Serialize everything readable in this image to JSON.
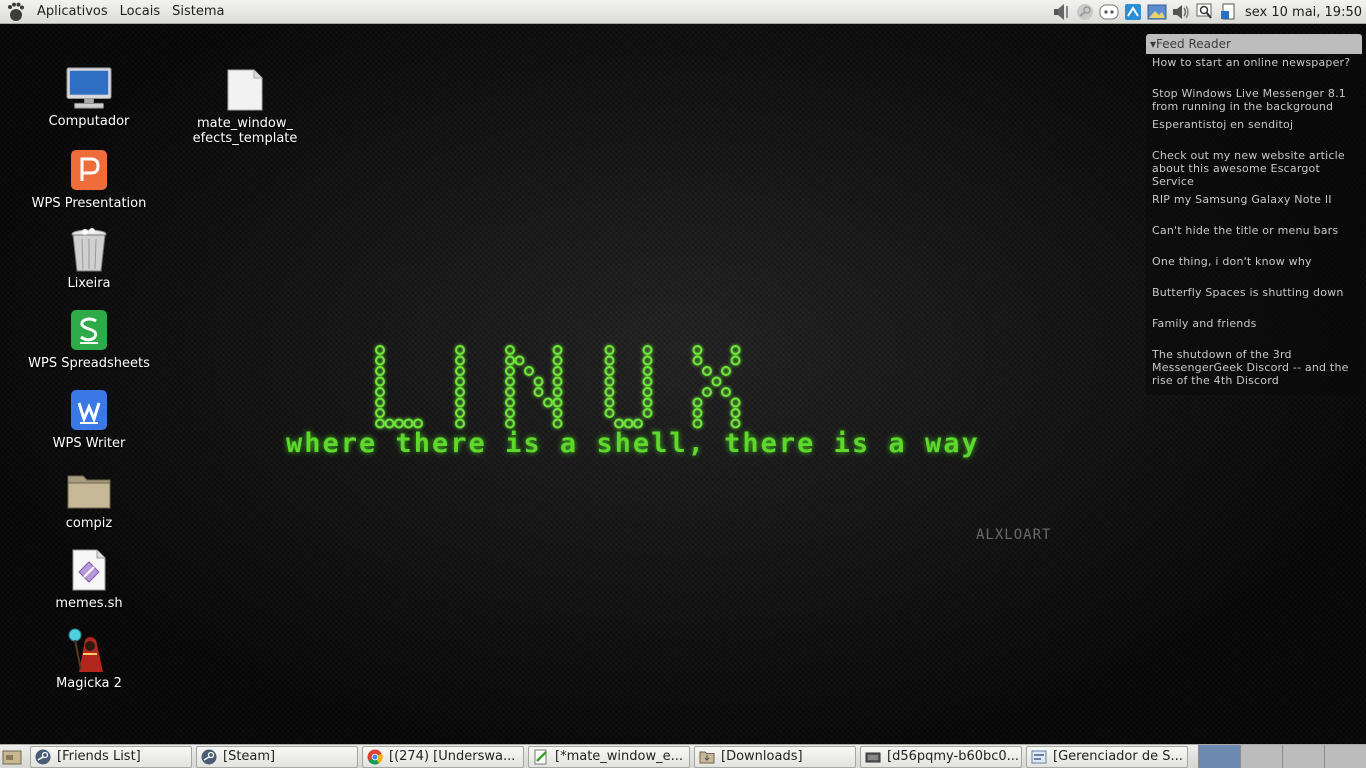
{
  "top_panel": {
    "menus": [
      "Aplicativos",
      "Locais",
      "Sistema"
    ],
    "clock": "sex 10 mai, 19:50"
  },
  "desktop_icons": [
    {
      "label": "Computador",
      "icon": "computer-icon"
    },
    {
      "label": "WPS Presentation",
      "icon": "wps-presentation-icon"
    },
    {
      "label": "Lixeira",
      "icon": "trash-icon"
    },
    {
      "label": "WPS Spreadsheets",
      "icon": "wps-spreadsheets-icon"
    },
    {
      "label": "WPS Writer",
      "icon": "wps-writer-icon"
    },
    {
      "label": "compiz",
      "icon": "folder-icon"
    },
    {
      "label": "memes.sh",
      "icon": "script-file-icon"
    },
    {
      "label": "Magicka 2",
      "icon": "magicka-game-icon"
    },
    {
      "label": "mate_window_\nefects_template",
      "icon": "blank-file-icon"
    }
  ],
  "wallpaper": {
    "title": "LINUX",
    "tagline": "where there is a shell, there is a way",
    "artist": "ALXLOART",
    "accent": "#5ed82a"
  },
  "feed_reader": {
    "title": "Feed Reader",
    "items": [
      "How to start an online newspaper?",
      "Stop Windows Live Messenger 8.1 from running in the background",
      "Esperantistoj en senditoj",
      "Check out my new website article about this awesome Escargot Service",
      "RIP my Samsung Galaxy Note II",
      "Can't hide the title or menu bars",
      "One thing, i don't know why",
      "Butterfly Spaces is shutting down",
      "Family and friends",
      "The shutdown of the 3rd MessengerGeek Discord -- and the rise of the 4th Discord"
    ]
  },
  "taskbar": {
    "tasks": [
      {
        "label": "[Friends List]",
        "icon": "steam-icon"
      },
      {
        "label": "[Steam]",
        "icon": "steam-icon"
      },
      {
        "label": "[(274) [Underswa...",
        "icon": "chrome-icon"
      },
      {
        "label": "[*mate_window_e...",
        "icon": "text-editor-icon"
      },
      {
        "label": "[Downloads]",
        "icon": "folder-icon"
      },
      {
        "label": "[d56pqmy-b60bc0...",
        "icon": "image-viewer-icon"
      },
      {
        "label": "[Gerenciador de S...",
        "icon": "file-manager-icon"
      }
    ],
    "workspaces": 4,
    "active_workspace": 1
  }
}
